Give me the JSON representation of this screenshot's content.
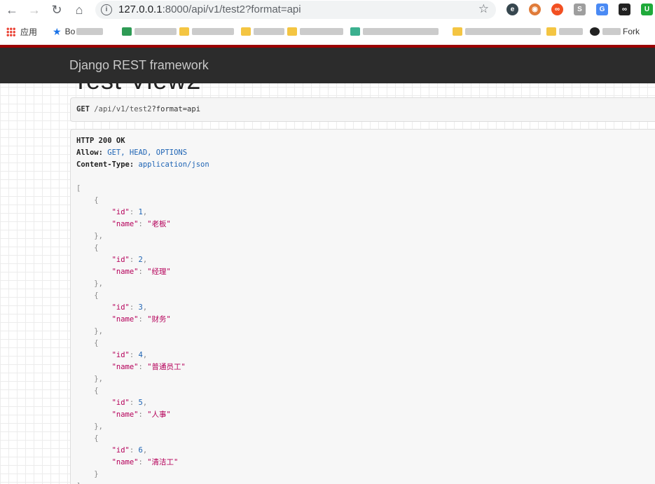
{
  "browser": {
    "url_host": "127.0.0.1",
    "url_rest": ":8000/api/v1/test2?format=api",
    "bookmarks": {
      "apps_label": "应用",
      "first_label": "Bo",
      "last_label": "Fork"
    }
  },
  "drf": {
    "brand": "Django REST framework",
    "heading": "Test View2",
    "request": {
      "method": "GET",
      "path": "/api/v1/test2",
      "query": "?format=api"
    },
    "response": {
      "status": "HTTP 200 OK",
      "allow_label": "Allow:",
      "allow_value": "GET, HEAD, OPTIONS",
      "content_type_label": "Content-Type:",
      "content_type_value": "application/json",
      "items": [
        {
          "id": 1,
          "name": "老板"
        },
        {
          "id": 2,
          "name": "经理"
        },
        {
          "id": 3,
          "name": "财务"
        },
        {
          "id": 4,
          "name": "普通员工"
        },
        {
          "id": 5,
          "name": "人事"
        },
        {
          "id": 6,
          "name": "清洁工"
        }
      ]
    }
  }
}
